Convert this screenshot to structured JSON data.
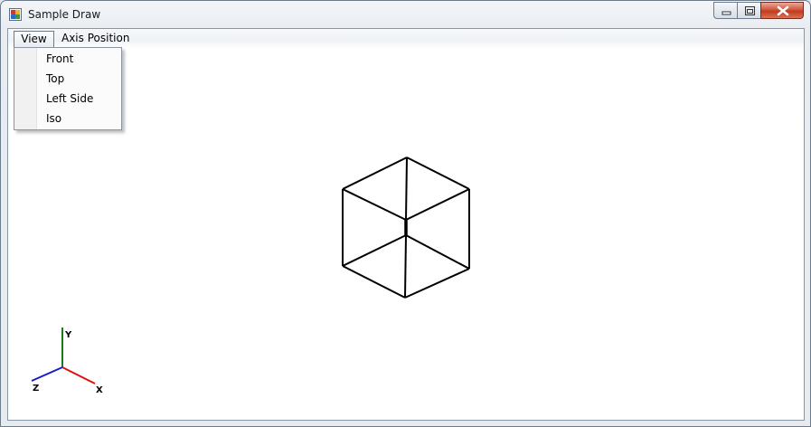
{
  "window": {
    "title": "Sample Draw"
  },
  "menu": {
    "items": [
      {
        "label": "View"
      },
      {
        "label": "Axis Position"
      }
    ],
    "view_dropdown": [
      {
        "label": "Front"
      },
      {
        "label": "Top"
      },
      {
        "label": "Left Side"
      },
      {
        "label": "Iso"
      }
    ]
  },
  "axes_gizmo": {
    "x_label": "X",
    "y_label": "Y",
    "z_label": "Z",
    "colors": {
      "x": "#e01010",
      "y": "#1a7a1a",
      "z": "#1a1ad0"
    }
  },
  "drawing": {
    "object": "cube",
    "view": "iso",
    "line_color": "#000000"
  }
}
